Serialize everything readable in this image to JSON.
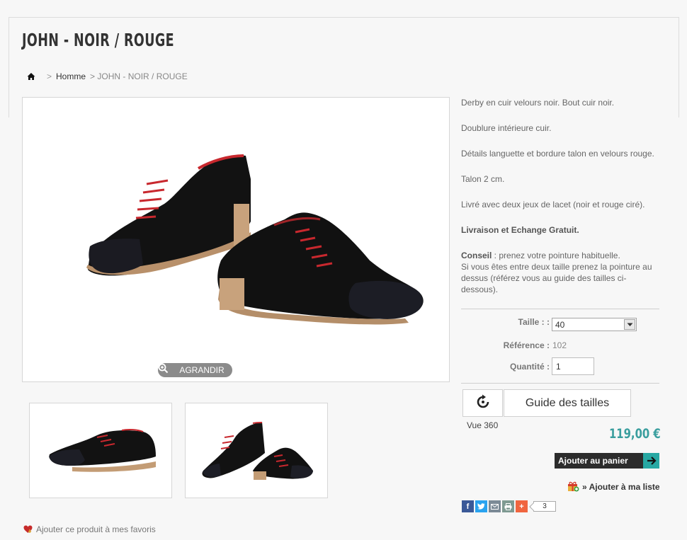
{
  "page": {
    "title": "JOHN - NOIR / ROUGE"
  },
  "breadcrumb": {
    "separator": ">",
    "home_link": "Homme",
    "current": "> JOHN - NOIR / ROUGE"
  },
  "image": {
    "zoom_label": "AGRANDIR"
  },
  "description": {
    "p1": "Derby en cuir velours noir. Bout cuir noir.",
    "p2": "Doublure intérieure cuir.",
    "p3": "Détails languette et bordure talon en velours rouge.",
    "p4": "Talon 2 cm.",
    "p5": "Livré avec deux jeux de lacet (noir et rouge ciré).",
    "p6": "Livraison et Echange Gratuit.",
    "advice_label": "Conseil",
    "advice_text": " : prenez votre pointure habituelle.",
    "advice_more": "Si vous êtes entre deux taille prenez la pointure au dessus (référez vous au guide des tailles ci-dessous)."
  },
  "options": {
    "size_label": "Taille : :",
    "size_value": "40",
    "reference_label": "Référence :",
    "reference_value": "102",
    "quantity_label": "Quantité :",
    "quantity_value": "1"
  },
  "actions": {
    "view360_label": "Vue 360",
    "size_guide_label": "Guide des tailles",
    "price": "119,00 €",
    "add_to_cart_label": "Ajouter au panier",
    "wishlist_label": "» Ajouter à ma liste",
    "share_count": "3",
    "favorite_label": "Ajouter ce produit à mes favoris"
  },
  "colors": {
    "price": "#3a9e9e",
    "cart_arrow": "#27a8a3",
    "cart_bg": "#2c2c2c"
  },
  "icons": [
    "home-icon",
    "zoom-in-icon",
    "rotate-360-icon",
    "arrow-right-icon",
    "gift-icon",
    "heart-icon",
    "facebook-icon",
    "twitter-icon",
    "email-icon",
    "print-icon",
    "plus-icon"
  ]
}
